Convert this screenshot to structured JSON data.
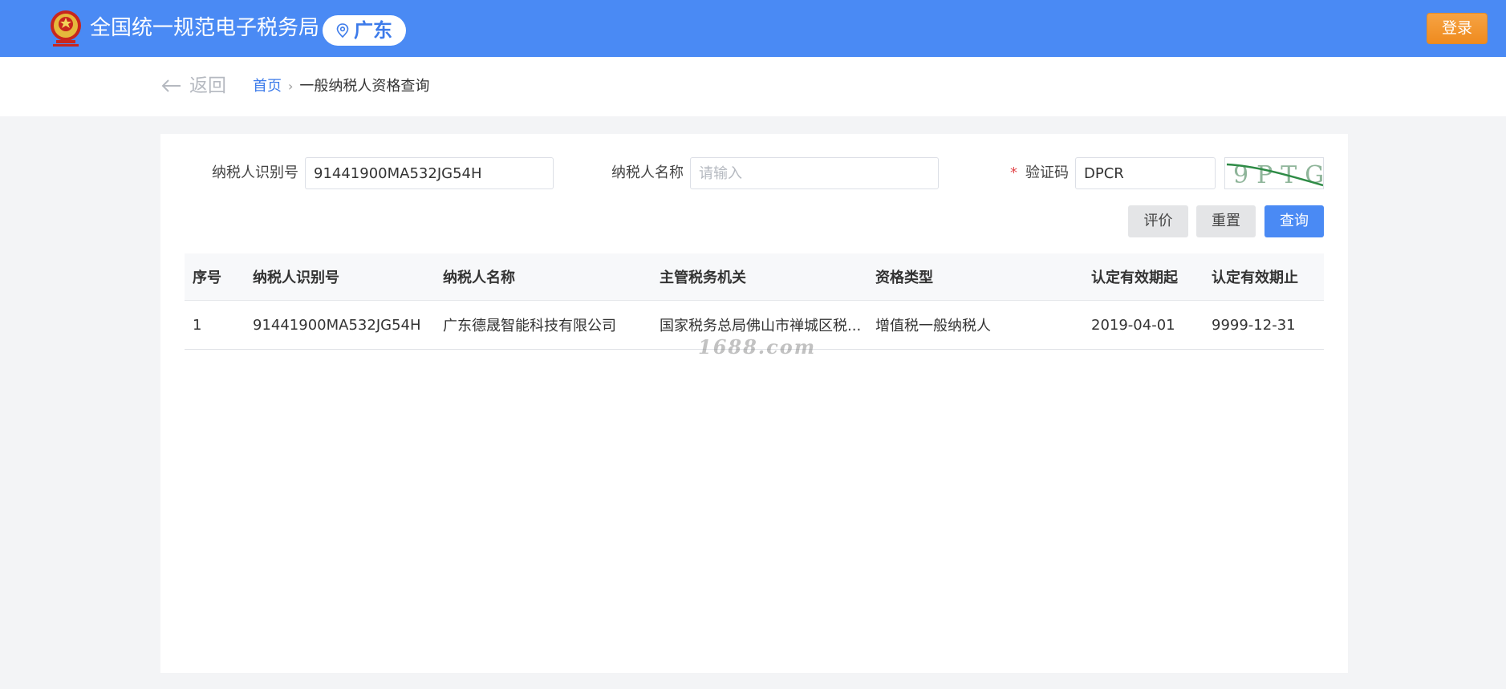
{
  "header": {
    "site_title": "全国统一规范电子税务局",
    "region": "广东",
    "login_label": "登录",
    "emblem_icon": "national-emblem-icon",
    "colors": {
      "bar": "#4a8af4",
      "login": "#f29530",
      "accent": "#3d7bea"
    }
  },
  "nav": {
    "back_label": "返回",
    "breadcrumb": {
      "home": "首页",
      "separator": "›",
      "current": "一般纳税人资格查询"
    }
  },
  "form": {
    "taxpayer_id": {
      "label": "纳税人识别号",
      "value": "91441900MA532JG54H"
    },
    "taxpayer_name": {
      "label": "纳税人名称",
      "value": "",
      "placeholder": "请输入"
    },
    "captcha": {
      "required_mark": "*",
      "label": "验证码",
      "value": "DPCR",
      "image_text": "9PTG"
    },
    "buttons": {
      "evaluate": "评价",
      "reset": "重置",
      "query": "查询"
    }
  },
  "table": {
    "columns": [
      "序号",
      "纳税人识别号",
      "纳税人名称",
      "主管税务机关",
      "资格类型",
      "认定有效期起",
      "认定有效期止"
    ],
    "rows": [
      [
        "1",
        "91441900MA532JG54H",
        "广东德晟智能科技有限公司",
        "国家税务总局佛山市禅城区税...",
        "增值税一般纳税人",
        "2019-04-01",
        "9999-12-31"
      ]
    ]
  },
  "watermark": "1688.com"
}
